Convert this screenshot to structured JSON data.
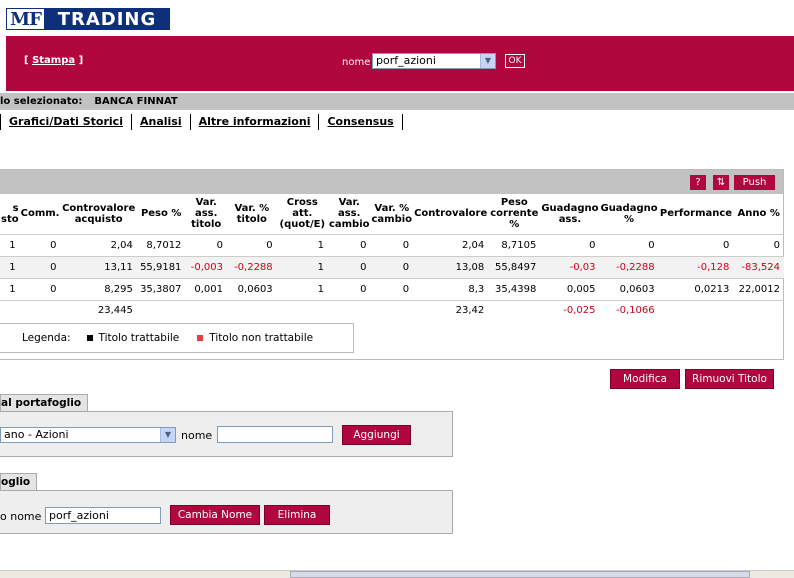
{
  "logo": {
    "mf": "MF",
    "trading": "TRADING"
  },
  "toolbar": {
    "stampa_open": "[ ",
    "stampa_label": "Stampa",
    "stampa_close": " ]",
    "nome_label": "nome",
    "portfolio_select_value": "porf_azioni",
    "ok_label": "OK"
  },
  "info": {
    "label": "lo selezionato:",
    "value": "BANCA FINNAT"
  },
  "tabs": [
    "Grafici/Dati Storici",
    "Analisi",
    "Altre informazioni",
    "Consensus"
  ],
  "grid_buttons": {
    "help": "?",
    "refresh": "⇅",
    "push": "Push"
  },
  "table": {
    "columns": [
      "s\nsto",
      "Comm.",
      "Controvalore\nacquisto",
      "Peso %",
      "Var.\nass.\ntitolo",
      "Var. %\ntitolo",
      "Cross\natt.\n(quot/E)",
      "Var.\nass.\ncambio",
      "Var. %\ncambio",
      "Controvalore",
      "Peso\ncorrente\n%",
      "Guadagno\nass.",
      "Guadagno\n%",
      "Performance",
      "Anno %"
    ],
    "rows": [
      [
        "1",
        "0",
        "2,04",
        "8,7012",
        "0",
        "0",
        "1",
        "0",
        "0",
        "2,04",
        "8,7105",
        "0",
        "0",
        "0",
        "0"
      ],
      [
        "1",
        "0",
        "13,11",
        "55,9181",
        "-0,003",
        "-0,2288",
        "1",
        "0",
        "0",
        "13,08",
        "55,8497",
        "-0,03",
        "-0,2288",
        "-0,128",
        "-83,524"
      ],
      [
        "1",
        "0",
        "8,295",
        "35,3807",
        "0,001",
        "0,0603",
        "1",
        "0",
        "0",
        "8,3",
        "35,4398",
        "0,005",
        "0,0603",
        "0,0213",
        "22,0012"
      ]
    ],
    "totals": {
      "controvalore_acquisto": "23,445",
      "controvalore": "23,42",
      "guadagno_ass": "-0,025",
      "guadagno_pct": "-0,1066"
    }
  },
  "legend": {
    "label": "Legenda:",
    "tradable": "Titolo trattabile",
    "not_tradable": "Titolo non trattabile"
  },
  "actions": {
    "modifica": "Modifica",
    "rimuovi": "Rimuovi Titolo"
  },
  "add_section": {
    "tab_label": "al portafoglio",
    "market_select_value": "ano - Azioni",
    "nome_label": "nome",
    "nome_value": "",
    "add_button": "Aggiungi"
  },
  "rename_section": {
    "tab_label": "oglio",
    "nome_label": "o nome",
    "nome_value": "porf_azioni",
    "rename_button": "Cambia Nome",
    "delete_button": "Elimina"
  },
  "colors": {
    "brand": "#b0073f",
    "negative": "#d0021b",
    "gray_bar": "#c2c2c2",
    "logo_blue": "#0e2f7a"
  }
}
